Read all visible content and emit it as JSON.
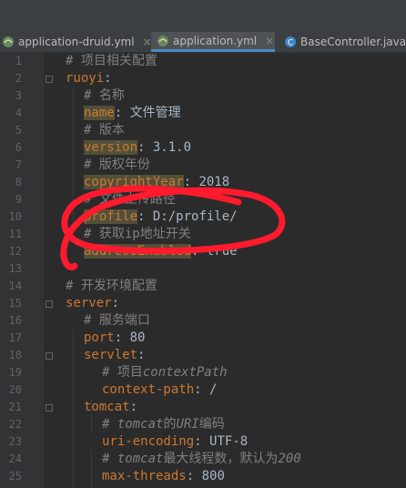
{
  "tabs": [
    {
      "label": "application-druid.yml",
      "close": "×",
      "active": false,
      "icon": "yaml-file-icon"
    },
    {
      "label": "application.yml",
      "close": "×",
      "active": true,
      "icon": "yaml-file-icon"
    },
    {
      "label": "BaseController.java",
      "close": "",
      "active": false,
      "icon": "java-class-icon"
    }
  ],
  "lines": [
    {
      "n": "1",
      "c": "# 项目相关配置"
    },
    {
      "n": "2",
      "k": "ruoyi",
      "p": ":"
    },
    {
      "n": "3",
      "c": "# 名称"
    },
    {
      "n": "4",
      "k": "name",
      "p": ":",
      "v": " 文件管理"
    },
    {
      "n": "5",
      "c": "# 版本"
    },
    {
      "n": "6",
      "k": "version",
      "p": ":",
      "v": " 3.1.0"
    },
    {
      "n": "7",
      "c": "# 版权年份"
    },
    {
      "n": "8",
      "k": "copyrightYear",
      "p": ":",
      "v": " 2018"
    },
    {
      "n": "9",
      "c": "# 文件上传路径"
    },
    {
      "n": "10",
      "k": "profile",
      "p": ":",
      "v": " D:/profile/"
    },
    {
      "n": "11",
      "c": "# 获取ip地址开关"
    },
    {
      "n": "12",
      "k": "addressEnabled",
      "p": ":",
      "v": " true"
    },
    {
      "n": "13"
    },
    {
      "n": "14",
      "c": "# 开发环境配置"
    },
    {
      "n": "15",
      "k": "server",
      "p": ":"
    },
    {
      "n": "16",
      "c": "# 服务端口"
    },
    {
      "n": "17",
      "k": "port",
      "p": ":",
      "v": " 80"
    },
    {
      "n": "18",
      "k": "servlet",
      "p": ":"
    },
    {
      "n": "19",
      "c": "# 项目",
      "ci": "contextPath"
    },
    {
      "n": "20",
      "k": "context-path",
      "p": ":",
      "v": " /"
    },
    {
      "n": "21",
      "k": "tomcat",
      "p": ":"
    },
    {
      "n": "22",
      "c": "# ",
      "ci": "tomcat",
      "c2": "的",
      "ci2": "URI",
      "c3": "编码"
    },
    {
      "n": "23",
      "k": "uri-encoding",
      "p": ":",
      "v": " UTF-8"
    },
    {
      "n": "24",
      "c": "# ",
      "ci": "tomcat",
      "c2": "最大线程数，默认为",
      "ci2": "200"
    },
    {
      "n": "25",
      "k": "max-threads",
      "p": ":",
      "v": " 800"
    }
  ],
  "colors": {
    "background": "#2b2b2b",
    "comment": "#808080",
    "key": "#cc7832",
    "value": "#a9b7c6",
    "annotation": "#ff1a2e",
    "active_tab_accent": "#4a88c7"
  }
}
